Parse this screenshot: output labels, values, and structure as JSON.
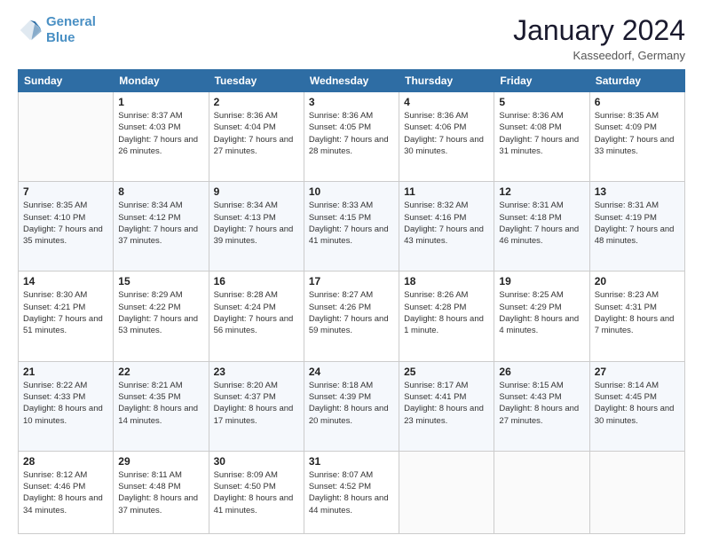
{
  "header": {
    "logo_line1": "General",
    "logo_line2": "Blue",
    "month_title": "January 2024",
    "location": "Kasseedorf, Germany"
  },
  "days_of_week": [
    "Sunday",
    "Monday",
    "Tuesday",
    "Wednesday",
    "Thursday",
    "Friday",
    "Saturday"
  ],
  "weeks": [
    [
      {
        "day": "",
        "sunrise": "",
        "sunset": "",
        "daylight": ""
      },
      {
        "day": "1",
        "sunrise": "Sunrise: 8:37 AM",
        "sunset": "Sunset: 4:03 PM",
        "daylight": "Daylight: 7 hours and 26 minutes."
      },
      {
        "day": "2",
        "sunrise": "Sunrise: 8:36 AM",
        "sunset": "Sunset: 4:04 PM",
        "daylight": "Daylight: 7 hours and 27 minutes."
      },
      {
        "day": "3",
        "sunrise": "Sunrise: 8:36 AM",
        "sunset": "Sunset: 4:05 PM",
        "daylight": "Daylight: 7 hours and 28 minutes."
      },
      {
        "day": "4",
        "sunrise": "Sunrise: 8:36 AM",
        "sunset": "Sunset: 4:06 PM",
        "daylight": "Daylight: 7 hours and 30 minutes."
      },
      {
        "day": "5",
        "sunrise": "Sunrise: 8:36 AM",
        "sunset": "Sunset: 4:08 PM",
        "daylight": "Daylight: 7 hours and 31 minutes."
      },
      {
        "day": "6",
        "sunrise": "Sunrise: 8:35 AM",
        "sunset": "Sunset: 4:09 PM",
        "daylight": "Daylight: 7 hours and 33 minutes."
      }
    ],
    [
      {
        "day": "7",
        "sunrise": "Sunrise: 8:35 AM",
        "sunset": "Sunset: 4:10 PM",
        "daylight": "Daylight: 7 hours and 35 minutes."
      },
      {
        "day": "8",
        "sunrise": "Sunrise: 8:34 AM",
        "sunset": "Sunset: 4:12 PM",
        "daylight": "Daylight: 7 hours and 37 minutes."
      },
      {
        "day": "9",
        "sunrise": "Sunrise: 8:34 AM",
        "sunset": "Sunset: 4:13 PM",
        "daylight": "Daylight: 7 hours and 39 minutes."
      },
      {
        "day": "10",
        "sunrise": "Sunrise: 8:33 AM",
        "sunset": "Sunset: 4:15 PM",
        "daylight": "Daylight: 7 hours and 41 minutes."
      },
      {
        "day": "11",
        "sunrise": "Sunrise: 8:32 AM",
        "sunset": "Sunset: 4:16 PM",
        "daylight": "Daylight: 7 hours and 43 minutes."
      },
      {
        "day": "12",
        "sunrise": "Sunrise: 8:31 AM",
        "sunset": "Sunset: 4:18 PM",
        "daylight": "Daylight: 7 hours and 46 minutes."
      },
      {
        "day": "13",
        "sunrise": "Sunrise: 8:31 AM",
        "sunset": "Sunset: 4:19 PM",
        "daylight": "Daylight: 7 hours and 48 minutes."
      }
    ],
    [
      {
        "day": "14",
        "sunrise": "Sunrise: 8:30 AM",
        "sunset": "Sunset: 4:21 PM",
        "daylight": "Daylight: 7 hours and 51 minutes."
      },
      {
        "day": "15",
        "sunrise": "Sunrise: 8:29 AM",
        "sunset": "Sunset: 4:22 PM",
        "daylight": "Daylight: 7 hours and 53 minutes."
      },
      {
        "day": "16",
        "sunrise": "Sunrise: 8:28 AM",
        "sunset": "Sunset: 4:24 PM",
        "daylight": "Daylight: 7 hours and 56 minutes."
      },
      {
        "day": "17",
        "sunrise": "Sunrise: 8:27 AM",
        "sunset": "Sunset: 4:26 PM",
        "daylight": "Daylight: 7 hours and 59 minutes."
      },
      {
        "day": "18",
        "sunrise": "Sunrise: 8:26 AM",
        "sunset": "Sunset: 4:28 PM",
        "daylight": "Daylight: 8 hours and 1 minute."
      },
      {
        "day": "19",
        "sunrise": "Sunrise: 8:25 AM",
        "sunset": "Sunset: 4:29 PM",
        "daylight": "Daylight: 8 hours and 4 minutes."
      },
      {
        "day": "20",
        "sunrise": "Sunrise: 8:23 AM",
        "sunset": "Sunset: 4:31 PM",
        "daylight": "Daylight: 8 hours and 7 minutes."
      }
    ],
    [
      {
        "day": "21",
        "sunrise": "Sunrise: 8:22 AM",
        "sunset": "Sunset: 4:33 PM",
        "daylight": "Daylight: 8 hours and 10 minutes."
      },
      {
        "day": "22",
        "sunrise": "Sunrise: 8:21 AM",
        "sunset": "Sunset: 4:35 PM",
        "daylight": "Daylight: 8 hours and 14 minutes."
      },
      {
        "day": "23",
        "sunrise": "Sunrise: 8:20 AM",
        "sunset": "Sunset: 4:37 PM",
        "daylight": "Daylight: 8 hours and 17 minutes."
      },
      {
        "day": "24",
        "sunrise": "Sunrise: 8:18 AM",
        "sunset": "Sunset: 4:39 PM",
        "daylight": "Daylight: 8 hours and 20 minutes."
      },
      {
        "day": "25",
        "sunrise": "Sunrise: 8:17 AM",
        "sunset": "Sunset: 4:41 PM",
        "daylight": "Daylight: 8 hours and 23 minutes."
      },
      {
        "day": "26",
        "sunrise": "Sunrise: 8:15 AM",
        "sunset": "Sunset: 4:43 PM",
        "daylight": "Daylight: 8 hours and 27 minutes."
      },
      {
        "day": "27",
        "sunrise": "Sunrise: 8:14 AM",
        "sunset": "Sunset: 4:45 PM",
        "daylight": "Daylight: 8 hours and 30 minutes."
      }
    ],
    [
      {
        "day": "28",
        "sunrise": "Sunrise: 8:12 AM",
        "sunset": "Sunset: 4:46 PM",
        "daylight": "Daylight: 8 hours and 34 minutes."
      },
      {
        "day": "29",
        "sunrise": "Sunrise: 8:11 AM",
        "sunset": "Sunset: 4:48 PM",
        "daylight": "Daylight: 8 hours and 37 minutes."
      },
      {
        "day": "30",
        "sunrise": "Sunrise: 8:09 AM",
        "sunset": "Sunset: 4:50 PM",
        "daylight": "Daylight: 8 hours and 41 minutes."
      },
      {
        "day": "31",
        "sunrise": "Sunrise: 8:07 AM",
        "sunset": "Sunset: 4:52 PM",
        "daylight": "Daylight: 8 hours and 44 minutes."
      },
      {
        "day": "",
        "sunrise": "",
        "sunset": "",
        "daylight": ""
      },
      {
        "day": "",
        "sunrise": "",
        "sunset": "",
        "daylight": ""
      },
      {
        "day": "",
        "sunrise": "",
        "sunset": "",
        "daylight": ""
      }
    ]
  ]
}
